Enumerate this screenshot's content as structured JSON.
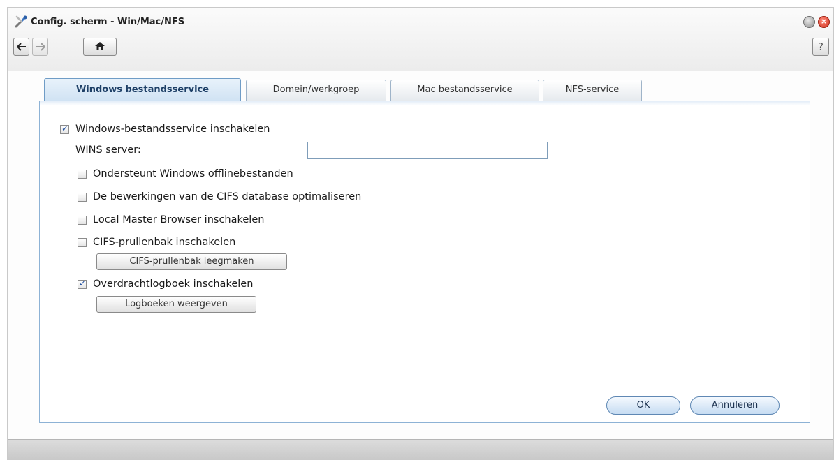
{
  "window": {
    "title": "Config. scherm - Win/Mac/NFS",
    "app_icon": "tools-icon",
    "help_label": "?"
  },
  "tabs": [
    {
      "label": "Windows bestandsservice",
      "active": true
    },
    {
      "label": "Domein/werkgroep",
      "active": false
    },
    {
      "label": "Mac bestandsservice",
      "active": false
    },
    {
      "label": "NFS-service",
      "active": false
    }
  ],
  "form": {
    "enable_windows": {
      "label": "Windows-bestandsservice inschakelen",
      "checked": true
    },
    "wins": {
      "label": "WINS server:",
      "value": ""
    },
    "offline_files": {
      "label": "Ondersteunt Windows offlinebestanden",
      "checked": false
    },
    "cifs_db": {
      "label": "De bewerkingen van de CIFS database optimaliseren",
      "checked": false
    },
    "master_browser": {
      "label": "Local Master Browser inschakelen",
      "checked": false
    },
    "recycle_bin": {
      "label": "CIFS-prullenbak inschakelen",
      "checked": false
    },
    "empty_bin_button": "CIFS-prullenbak leegmaken",
    "transfer_log": {
      "label": "Overdrachtlogboek inschakelen",
      "checked": true
    },
    "view_logs_button": "Logboeken weergeven"
  },
  "actions": {
    "ok": "OK",
    "cancel": "Annuleren"
  },
  "colors": {
    "accent": "#6f9cc6",
    "close_button": "#d0311e"
  }
}
